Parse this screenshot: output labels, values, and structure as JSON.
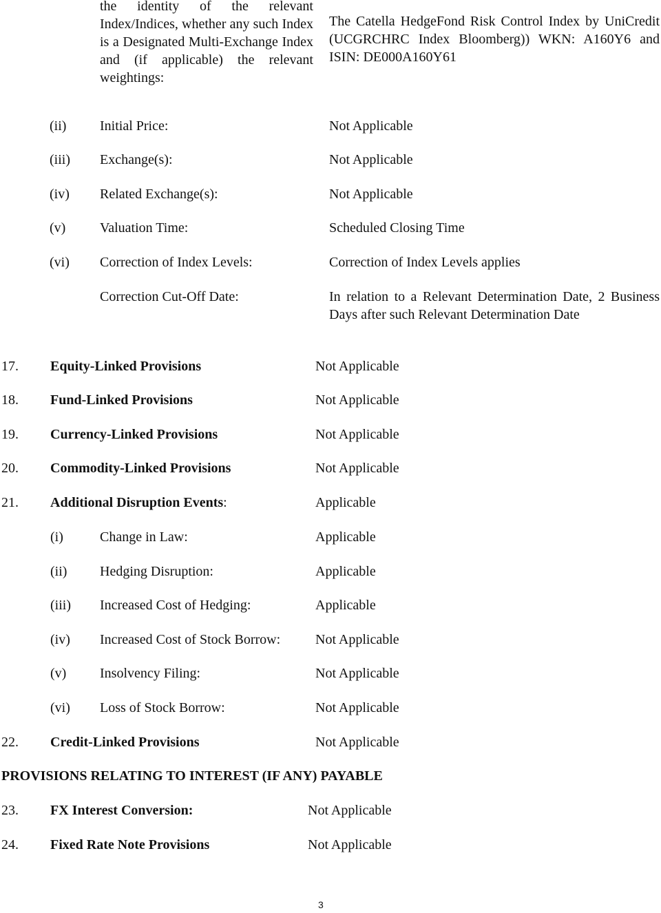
{
  "index_identity": {
    "label": "the identity of the relevant Index/Indices, whether any such Index is a Designated Multi-Exchange Index and (if applicable) the relevant weightings:",
    "value": "The Catella HedgeFond Risk Control Index by UniCredit (UCGRCHRC Index Bloomberg)) WKN: A160Y6 and ISIN: DE000A160Y61"
  },
  "index_items": [
    {
      "num": "(ii)",
      "label": "Initial Price:",
      "value": "Not Applicable"
    },
    {
      "num": "(iii)",
      "label": "Exchange(s):",
      "value": "Not Applicable"
    },
    {
      "num": "(iv)",
      "label": "Related Exchange(s):",
      "value": "Not Applicable"
    },
    {
      "num": "(v)",
      "label": "Valuation Time:",
      "value": "Scheduled Closing Time"
    },
    {
      "num": "(vi)",
      "label": "Correction of Index Levels:",
      "value": "Correction of Index Levels applies"
    }
  ],
  "correction_cutoff": {
    "label": "Correction Cut-Off Date:",
    "value": "In relation to a Relevant Determination Date, 2 Business Days after such Relevant Determination Date"
  },
  "provisions": [
    {
      "num": "17.",
      "label": "Equity-Linked Provisions",
      "value": "Not Applicable"
    },
    {
      "num": "18.",
      "label": "Fund-Linked Provisions",
      "value": "Not Applicable"
    },
    {
      "num": "19.",
      "label": "Currency-Linked Provisions",
      "value": "Not Applicable"
    },
    {
      "num": "20.",
      "label": "Commodity-Linked Provisions",
      "value": "Not Applicable"
    },
    {
      "num": "21.",
      "label": "Additional Disruption Events",
      "label_suffix": ":",
      "value": "Applicable"
    }
  ],
  "disruption_events": [
    {
      "num": "(i)",
      "label": "Change in Law:",
      "value": "Applicable"
    },
    {
      "num": "(ii)",
      "label": "Hedging Disruption:",
      "value": "Applicable"
    },
    {
      "num": "(iii)",
      "label": "Increased Cost of Hedging:",
      "value": "Applicable"
    },
    {
      "num": "(iv)",
      "label": "Increased Cost of Stock Borrow:",
      "value": "Not Applicable"
    },
    {
      "num": "(v)",
      "label": "Insolvency Filing:",
      "value": "Not Applicable"
    },
    {
      "num": "(vi)",
      "label": "Loss of Stock Borrow:",
      "value": "Not Applicable"
    }
  ],
  "credit_linked": {
    "num": "22.",
    "label": "Credit-Linked Provisions",
    "value": "Not Applicable"
  },
  "interest_heading": "PROVISIONS RELATING TO INTEREST (IF ANY) PAYABLE",
  "interest_items": [
    {
      "num": "23.",
      "label": "FX Interest Conversion:",
      "value": "Not Applicable"
    },
    {
      "num": "24.",
      "label": "Fixed Rate Note Provisions",
      "value": "Not Applicable"
    }
  ],
  "page_number": "3"
}
